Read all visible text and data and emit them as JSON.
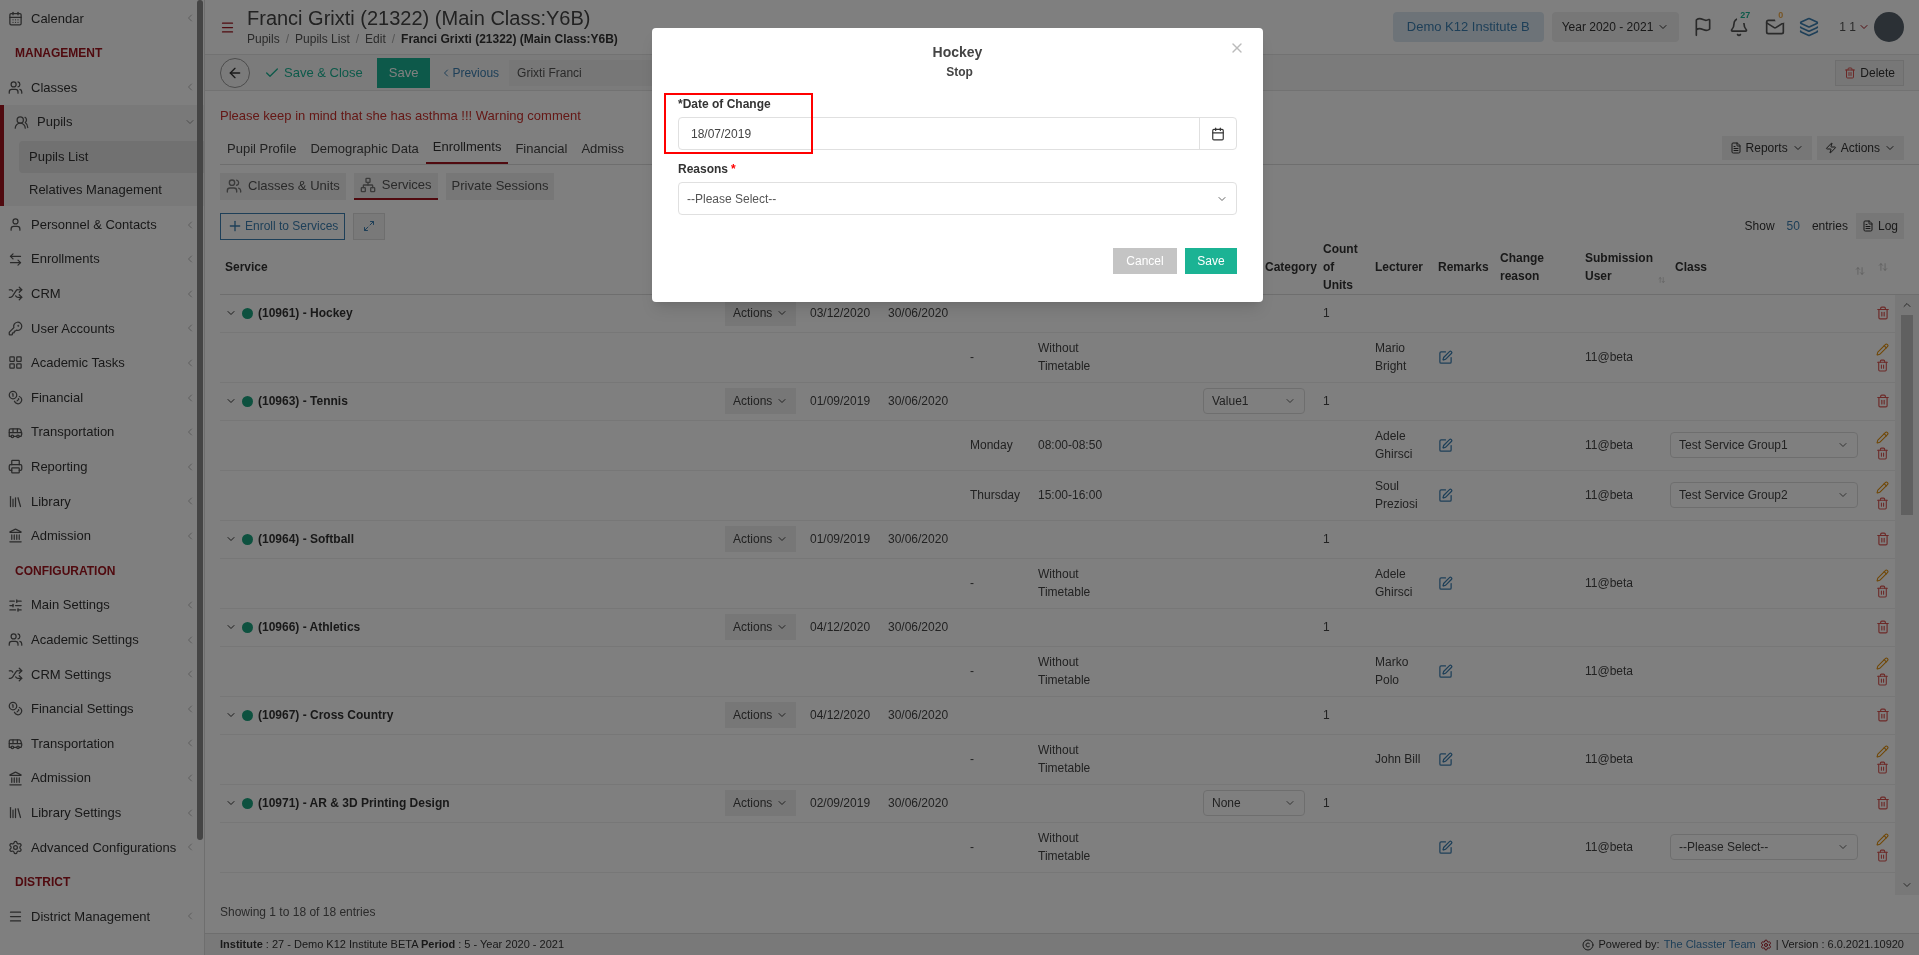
{
  "sidebar": {
    "items": [
      {
        "kind": "link",
        "label": "Calendar",
        "selected": false
      },
      {
        "kind": "heading",
        "label": "MANAGEMENT"
      },
      {
        "kind": "link",
        "label": "Classes",
        "selected": false
      },
      {
        "kind": "group",
        "label": "Pupils",
        "expanded": true,
        "children": [
          {
            "label": "Pupils List",
            "selected": true
          },
          {
            "label": "Relatives Management",
            "selected": false
          }
        ]
      },
      {
        "kind": "link",
        "label": "Personnel & Contacts",
        "selected": false
      },
      {
        "kind": "link",
        "label": "Enrollments",
        "selected": false
      },
      {
        "kind": "link",
        "label": "CRM",
        "selected": false
      },
      {
        "kind": "link",
        "label": "User Accounts",
        "selected": false
      },
      {
        "kind": "link",
        "label": "Academic Tasks",
        "selected": false
      },
      {
        "kind": "link",
        "label": "Financial",
        "selected": false
      },
      {
        "kind": "link",
        "label": "Transportation",
        "selected": false
      },
      {
        "kind": "link",
        "label": "Reporting",
        "selected": false
      },
      {
        "kind": "link",
        "label": "Library",
        "selected": false
      },
      {
        "kind": "link",
        "label": "Admission",
        "selected": false
      },
      {
        "kind": "heading",
        "label": "CONFIGURATION"
      },
      {
        "kind": "link",
        "label": "Main Settings",
        "selected": false
      },
      {
        "kind": "link",
        "label": "Academic Settings",
        "selected": false
      },
      {
        "kind": "link",
        "label": "CRM Settings",
        "selected": false
      },
      {
        "kind": "link",
        "label": "Financial Settings",
        "selected": false
      },
      {
        "kind": "link",
        "label": "Transportation",
        "selected": false
      },
      {
        "kind": "link",
        "label": "Admission",
        "selected": false
      },
      {
        "kind": "link",
        "label": "Library Settings",
        "selected": false
      },
      {
        "kind": "link",
        "label": "Advanced Configurations",
        "selected": false
      },
      {
        "kind": "heading",
        "label": "DISTRICT"
      },
      {
        "kind": "link",
        "label": "District Management",
        "selected": false
      }
    ]
  },
  "header": {
    "title": "Franci Grixti (21322) (Main Class:Y6B)",
    "breadcrumb_separator": "/",
    "breadcrumb": [
      "Pupils",
      "Pupils List",
      "Edit",
      "Franci Grixti (21322) (Main Class:Y6B)"
    ],
    "institute": "Demo K12 Institute B",
    "year": "Year 2020 - 2021",
    "notifications": "27",
    "messages": "0",
    "user": "1 1"
  },
  "toolbar": {
    "save_close": "Save & Close",
    "save": "Save",
    "previous": "Previous",
    "search_value": "Grixti Franci",
    "delete": "Delete"
  },
  "warning": "Please keep in mind that she has asthma !!! Warning comment",
  "tabs": [
    {
      "label": "Pupil Profile",
      "selected": false
    },
    {
      "label": "Demographic Data",
      "selected": false
    },
    {
      "label": "Enrollments",
      "selected": true
    },
    {
      "label": "Financial",
      "selected": false
    },
    {
      "label": "Admiss",
      "selected": false
    }
  ],
  "tab_actions": [
    "Reports",
    "Actions"
  ],
  "subtabs": [
    {
      "label": "Classes & Units",
      "selected": false
    },
    {
      "label": "Services",
      "selected": true
    },
    {
      "label": "Private Sessions",
      "selected": false
    }
  ],
  "enroll_button": "Enroll to Services",
  "page_length": {
    "show": "Show",
    "value": "50",
    "entries": "entries",
    "log": "Log"
  },
  "table": {
    "columns": [
      "Service",
      "Category",
      "Count of Units",
      "Lecturer",
      "Remarks",
      "Change reason",
      "Submission User",
      "Class"
    ],
    "rows": [
      {
        "service": "(10961) - Hockey",
        "expanded": true,
        "actions": "Actions",
        "start": "03/12/2020",
        "end": "30/06/2020",
        "count": "1",
        "sessions": [
          {
            "day": "-",
            "time": "Without Timetable",
            "lecturer": "Mario Bright",
            "user": "11@beta"
          }
        ]
      },
      {
        "service": "(10963) - Tennis",
        "expanded": true,
        "actions": "Actions",
        "start": "01/09/2019",
        "end": "30/06/2020",
        "category": "Value1",
        "count": "1",
        "sessions": [
          {
            "day": "Monday",
            "time": "08:00-08:50",
            "lecturer": "Adele Ghirsci",
            "user": "11@beta",
            "class": "Test Service Group1"
          },
          {
            "day": "Thursday",
            "time": "15:00-16:00",
            "lecturer": "Soul Preziosi",
            "user": "11@beta",
            "class": "Test Service Group2"
          }
        ]
      },
      {
        "service": "(10964) - Softball",
        "expanded": true,
        "actions": "Actions",
        "start": "01/09/2019",
        "end": "30/06/2020",
        "count": "1",
        "sessions": [
          {
            "day": "-",
            "time": "Without Timetable",
            "lecturer": "Adele Ghirsci",
            "user": "11@beta"
          }
        ]
      },
      {
        "service": "(10966) - Athletics",
        "expanded": true,
        "actions": "Actions",
        "start": "04/12/2020",
        "end": "30/06/2020",
        "count": "1",
        "sessions": [
          {
            "day": "-",
            "time": "Without Timetable",
            "lecturer": "Marko Polo",
            "user": "11@beta"
          }
        ]
      },
      {
        "service": "(10967) - Cross Country",
        "expanded": true,
        "actions": "Actions",
        "start": "04/12/2020",
        "end": "30/06/2020",
        "count": "1",
        "sessions": [
          {
            "day": "-",
            "time": "Without Timetable",
            "lecturer": "John Bill",
            "user": "11@beta"
          }
        ]
      },
      {
        "service": "(10971) - AR & 3D Printing Design",
        "expanded": true,
        "actions": "Actions",
        "start": "02/09/2019",
        "end": "30/06/2020",
        "category": "None",
        "count": "1",
        "sessions": [
          {
            "day": "-",
            "time": "Without Timetable",
            "user": "11@beta",
            "class": "--Please Select--"
          }
        ]
      }
    ],
    "info": "Showing 1 to 18 of 18 entries"
  },
  "footer": {
    "left": "**Institute** : 27 - Demo K12 Institute BETA **Period** : 5 - Year 2020 - 2021",
    "powered": "Powered by:",
    "team": "The Classter Team",
    "version": "| Version : 6.0.2021.10920"
  },
  "modal": {
    "title": "Hockey",
    "subtitle": "Stop",
    "date_label": "*Date of Change",
    "date_value": "18/07/2019",
    "highlighted": true,
    "reasons_label": "Reasons",
    "required_mark": "*",
    "reasons_placeholder": "--Please Select--",
    "cancel": "Cancel",
    "save": "Save"
  }
}
